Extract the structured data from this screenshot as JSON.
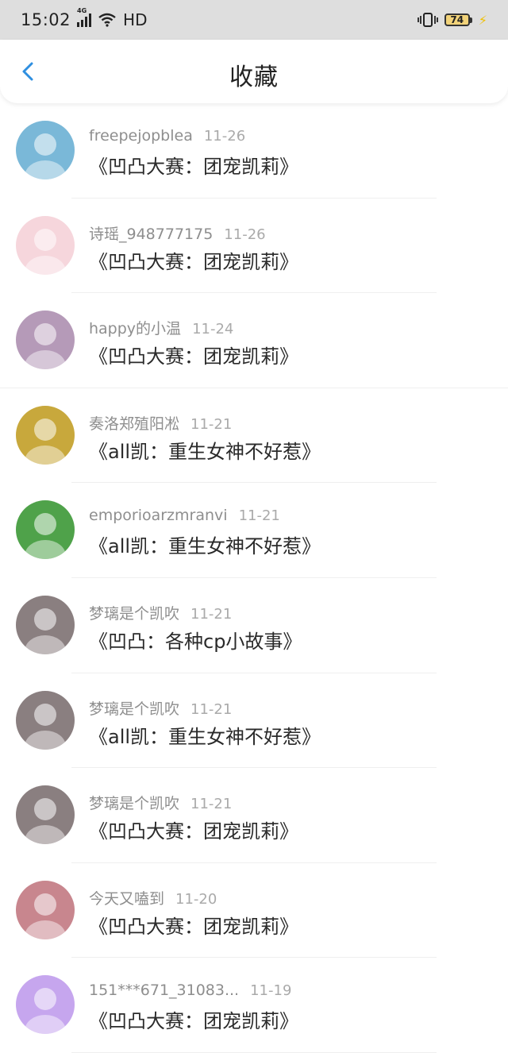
{
  "status": {
    "time": "15:02",
    "network": "4G",
    "hd": "HD",
    "battery": "74"
  },
  "header": {
    "title": "收藏"
  },
  "items": [
    {
      "user": "freepejopblea",
      "date": "11-26",
      "title": "《凹凸大赛：团宠凯莉》",
      "avatar_color": "#7ab8d8"
    },
    {
      "user": "诗瑶_948777175",
      "date": "11-26",
      "title": "《凹凸大赛：团宠凯莉》",
      "avatar_color": "#f6d6dc"
    },
    {
      "user": "happy的小温",
      "date": "11-24",
      "title": "《凹凸大赛：团宠凯莉》",
      "avatar_color": "#b59ab8"
    },
    {
      "user": "奏洛郑殖阳凇",
      "date": "11-21",
      "title": "《all凯：重生女神不好惹》",
      "avatar_color": "#c8a83c"
    },
    {
      "user": "emporioarzmranvi",
      "date": "11-21",
      "title": "《all凯：重生女神不好惹》",
      "avatar_color": "#4fa24a"
    },
    {
      "user": "梦璃是个凯吹",
      "date": "11-21",
      "title": "《凹凸：各种cp小故事》",
      "avatar_color": "#8a7f80"
    },
    {
      "user": "梦璃是个凯吹",
      "date": "11-21",
      "title": "《all凯：重生女神不好惹》",
      "avatar_color": "#8a7f80"
    },
    {
      "user": "梦璃是个凯吹",
      "date": "11-21",
      "title": "《凹凸大赛：团宠凯莉》",
      "avatar_color": "#8a7f80"
    },
    {
      "user": "今天又嗑到",
      "date": "11-20",
      "title": "《凹凸大赛：团宠凯莉》",
      "avatar_color": "#c8868e"
    },
    {
      "user": "151***671_31083...",
      "date": "11-19",
      "title": "《凹凸大赛：团宠凯莉》",
      "avatar_color": "#c6a6ee"
    }
  ]
}
